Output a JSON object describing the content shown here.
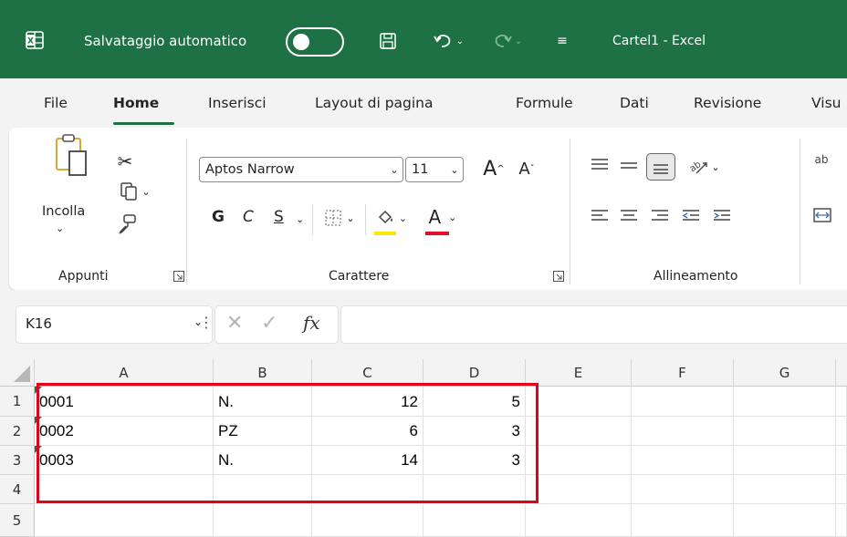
{
  "titlebar": {
    "autosave_label": "Salvataggio automatico",
    "title": "Cartel1  -  Excel"
  },
  "tabs": [
    "File",
    "Home",
    "Inserisci",
    "Layout di pagina",
    "Formule",
    "Dati",
    "Revisione",
    "Visu"
  ],
  "active_tab": "Home",
  "ribbon": {
    "clipboard": {
      "paste_label": "Incolla",
      "group_label": "Appunti"
    },
    "font": {
      "font_name": "Aptos Narrow",
      "font_size": "11",
      "bold": "G",
      "italic": "C",
      "underline": "S",
      "group_label": "Carattere",
      "grow_label": "A",
      "shrink_label": "A",
      "color_label": "A"
    },
    "alignment": {
      "group_label": "Allineamento"
    }
  },
  "formula_bar": {
    "name_box": "K16",
    "fx": "fx",
    "formula": ""
  },
  "grid": {
    "columns": [
      "A",
      "B",
      "C",
      "D",
      "E",
      "F",
      "G"
    ],
    "row_numbers": [
      "1",
      "2",
      "3",
      "4",
      "5"
    ],
    "rows": [
      [
        "0001",
        "N.",
        "12",
        "5"
      ],
      [
        "0002",
        "PZ",
        "6",
        "3"
      ],
      [
        "0003",
        "N.",
        "14",
        "3"
      ]
    ]
  },
  "colors": {
    "excel_green": "#1e7145",
    "highlight_red": "#e3001b",
    "fill_yellow": "#ffe600",
    "font_red": "#e81123"
  }
}
